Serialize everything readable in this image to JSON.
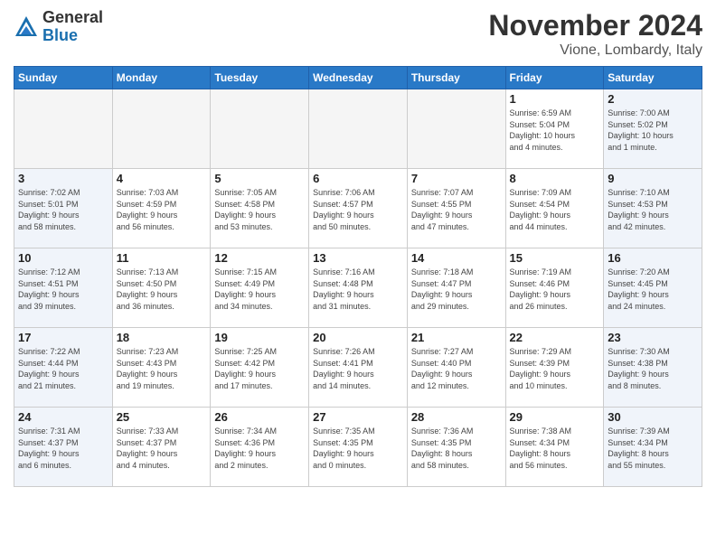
{
  "header": {
    "logo_general": "General",
    "logo_blue": "Blue",
    "month_title": "November 2024",
    "location": "Vione, Lombardy, Italy"
  },
  "weekdays": [
    "Sunday",
    "Monday",
    "Tuesday",
    "Wednesday",
    "Thursday",
    "Friday",
    "Saturday"
  ],
  "weeks": [
    [
      {
        "day": "",
        "info": "",
        "empty": true
      },
      {
        "day": "",
        "info": "",
        "empty": true
      },
      {
        "day": "",
        "info": "",
        "empty": true
      },
      {
        "day": "",
        "info": "",
        "empty": true
      },
      {
        "day": "",
        "info": "",
        "empty": true
      },
      {
        "day": "1",
        "info": "Sunrise: 6:59 AM\nSunset: 5:04 PM\nDaylight: 10 hours\nand 4 minutes.",
        "weekend": false
      },
      {
        "day": "2",
        "info": "Sunrise: 7:00 AM\nSunset: 5:02 PM\nDaylight: 10 hours\nand 1 minute.",
        "weekend": true
      }
    ],
    [
      {
        "day": "3",
        "info": "Sunrise: 7:02 AM\nSunset: 5:01 PM\nDaylight: 9 hours\nand 58 minutes.",
        "weekend": true
      },
      {
        "day": "4",
        "info": "Sunrise: 7:03 AM\nSunset: 4:59 PM\nDaylight: 9 hours\nand 56 minutes.",
        "weekend": false
      },
      {
        "day": "5",
        "info": "Sunrise: 7:05 AM\nSunset: 4:58 PM\nDaylight: 9 hours\nand 53 minutes.",
        "weekend": false
      },
      {
        "day": "6",
        "info": "Sunrise: 7:06 AM\nSunset: 4:57 PM\nDaylight: 9 hours\nand 50 minutes.",
        "weekend": false
      },
      {
        "day": "7",
        "info": "Sunrise: 7:07 AM\nSunset: 4:55 PM\nDaylight: 9 hours\nand 47 minutes.",
        "weekend": false
      },
      {
        "day": "8",
        "info": "Sunrise: 7:09 AM\nSunset: 4:54 PM\nDaylight: 9 hours\nand 44 minutes.",
        "weekend": false
      },
      {
        "day": "9",
        "info": "Sunrise: 7:10 AM\nSunset: 4:53 PM\nDaylight: 9 hours\nand 42 minutes.",
        "weekend": true
      }
    ],
    [
      {
        "day": "10",
        "info": "Sunrise: 7:12 AM\nSunset: 4:51 PM\nDaylight: 9 hours\nand 39 minutes.",
        "weekend": true
      },
      {
        "day": "11",
        "info": "Sunrise: 7:13 AM\nSunset: 4:50 PM\nDaylight: 9 hours\nand 36 minutes.",
        "weekend": false
      },
      {
        "day": "12",
        "info": "Sunrise: 7:15 AM\nSunset: 4:49 PM\nDaylight: 9 hours\nand 34 minutes.",
        "weekend": false
      },
      {
        "day": "13",
        "info": "Sunrise: 7:16 AM\nSunset: 4:48 PM\nDaylight: 9 hours\nand 31 minutes.",
        "weekend": false
      },
      {
        "day": "14",
        "info": "Sunrise: 7:18 AM\nSunset: 4:47 PM\nDaylight: 9 hours\nand 29 minutes.",
        "weekend": false
      },
      {
        "day": "15",
        "info": "Sunrise: 7:19 AM\nSunset: 4:46 PM\nDaylight: 9 hours\nand 26 minutes.",
        "weekend": false
      },
      {
        "day": "16",
        "info": "Sunrise: 7:20 AM\nSunset: 4:45 PM\nDaylight: 9 hours\nand 24 minutes.",
        "weekend": true
      }
    ],
    [
      {
        "day": "17",
        "info": "Sunrise: 7:22 AM\nSunset: 4:44 PM\nDaylight: 9 hours\nand 21 minutes.",
        "weekend": true
      },
      {
        "day": "18",
        "info": "Sunrise: 7:23 AM\nSunset: 4:43 PM\nDaylight: 9 hours\nand 19 minutes.",
        "weekend": false
      },
      {
        "day": "19",
        "info": "Sunrise: 7:25 AM\nSunset: 4:42 PM\nDaylight: 9 hours\nand 17 minutes.",
        "weekend": false
      },
      {
        "day": "20",
        "info": "Sunrise: 7:26 AM\nSunset: 4:41 PM\nDaylight: 9 hours\nand 14 minutes.",
        "weekend": false
      },
      {
        "day": "21",
        "info": "Sunrise: 7:27 AM\nSunset: 4:40 PM\nDaylight: 9 hours\nand 12 minutes.",
        "weekend": false
      },
      {
        "day": "22",
        "info": "Sunrise: 7:29 AM\nSunset: 4:39 PM\nDaylight: 9 hours\nand 10 minutes.",
        "weekend": false
      },
      {
        "day": "23",
        "info": "Sunrise: 7:30 AM\nSunset: 4:38 PM\nDaylight: 9 hours\nand 8 minutes.",
        "weekend": true
      }
    ],
    [
      {
        "day": "24",
        "info": "Sunrise: 7:31 AM\nSunset: 4:37 PM\nDaylight: 9 hours\nand 6 minutes.",
        "weekend": true
      },
      {
        "day": "25",
        "info": "Sunrise: 7:33 AM\nSunset: 4:37 PM\nDaylight: 9 hours\nand 4 minutes.",
        "weekend": false
      },
      {
        "day": "26",
        "info": "Sunrise: 7:34 AM\nSunset: 4:36 PM\nDaylight: 9 hours\nand 2 minutes.",
        "weekend": false
      },
      {
        "day": "27",
        "info": "Sunrise: 7:35 AM\nSunset: 4:35 PM\nDaylight: 9 hours\nand 0 minutes.",
        "weekend": false
      },
      {
        "day": "28",
        "info": "Sunrise: 7:36 AM\nSunset: 4:35 PM\nDaylight: 8 hours\nand 58 minutes.",
        "weekend": false
      },
      {
        "day": "29",
        "info": "Sunrise: 7:38 AM\nSunset: 4:34 PM\nDaylight: 8 hours\nand 56 minutes.",
        "weekend": false
      },
      {
        "day": "30",
        "info": "Sunrise: 7:39 AM\nSunset: 4:34 PM\nDaylight: 8 hours\nand 55 minutes.",
        "weekend": true
      }
    ]
  ]
}
